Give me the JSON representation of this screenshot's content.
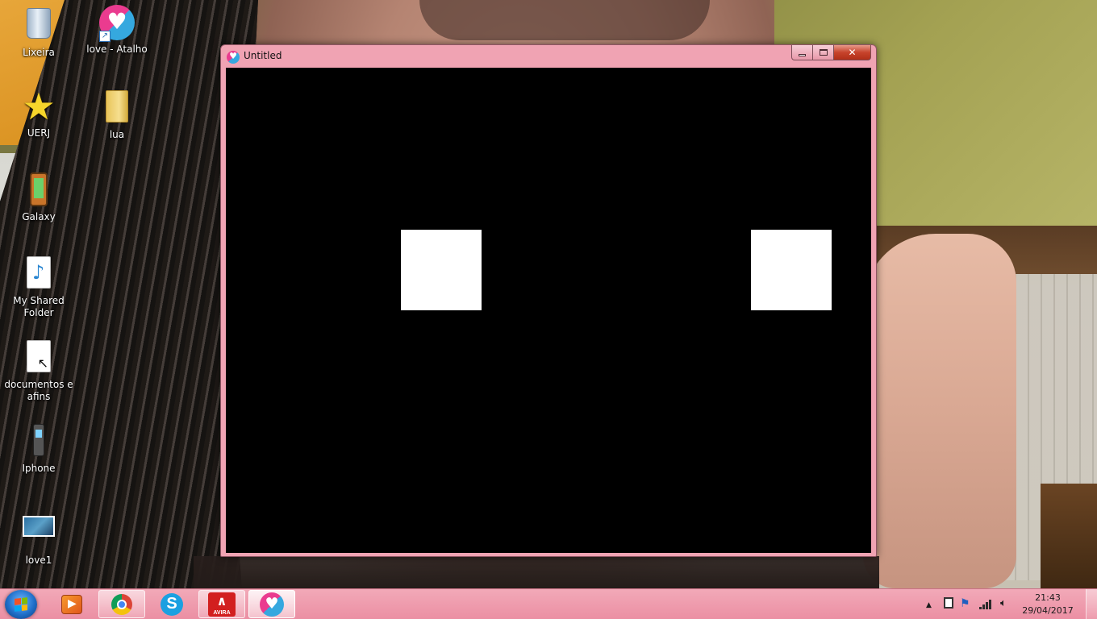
{
  "desktop": {
    "icons": [
      {
        "label": "Lixeira",
        "icon": "recycle-bin-icon"
      },
      {
        "label": "love - Atalho",
        "icon": "love-app-shortcut-icon"
      },
      {
        "label": "UERJ",
        "icon": "star-icon"
      },
      {
        "label": "lua",
        "icon": "folder-icon"
      },
      {
        "label": "Galaxy",
        "icon": "phone-icon"
      },
      {
        "label": "My Shared Folder",
        "icon": "music-document-icon"
      },
      {
        "label": "documentos e afins",
        "icon": "document-icon"
      },
      {
        "label": "Iphone",
        "icon": "mobile-phone-icon"
      },
      {
        "label": "love1",
        "icon": "image-thumbnail-icon"
      }
    ]
  },
  "window": {
    "title": "Untitled",
    "icon": "love-app-icon",
    "background_color": "#000000",
    "square_color": "#ffffff",
    "caption_buttons": {
      "minimize": "minimize-icon",
      "maximize": "maximize-icon",
      "close": "close-icon"
    }
  },
  "taskbar": {
    "start": "windows-start-icon",
    "apps": [
      {
        "name": "Windows Media Player",
        "icon": "media-player-icon",
        "state": "pinned"
      },
      {
        "name": "Google Chrome",
        "icon": "chrome-icon",
        "state": "running"
      },
      {
        "name": "Skype",
        "icon": "skype-icon",
        "state": "pinned"
      },
      {
        "name": "Avira",
        "icon": "avira-icon",
        "state": "running",
        "icon_text": "AVIRA"
      },
      {
        "name": "love",
        "icon": "love-app-icon",
        "state": "active"
      }
    ],
    "tray": {
      "icons": [
        "show-hidden-icons-arrow",
        "network-icon",
        "action-center-flag-icon",
        "signal-strength-icon",
        "volume-icon"
      ],
      "time": "21:43",
      "date": "29/04/2017"
    },
    "accent_color": "#eb8fa3"
  }
}
